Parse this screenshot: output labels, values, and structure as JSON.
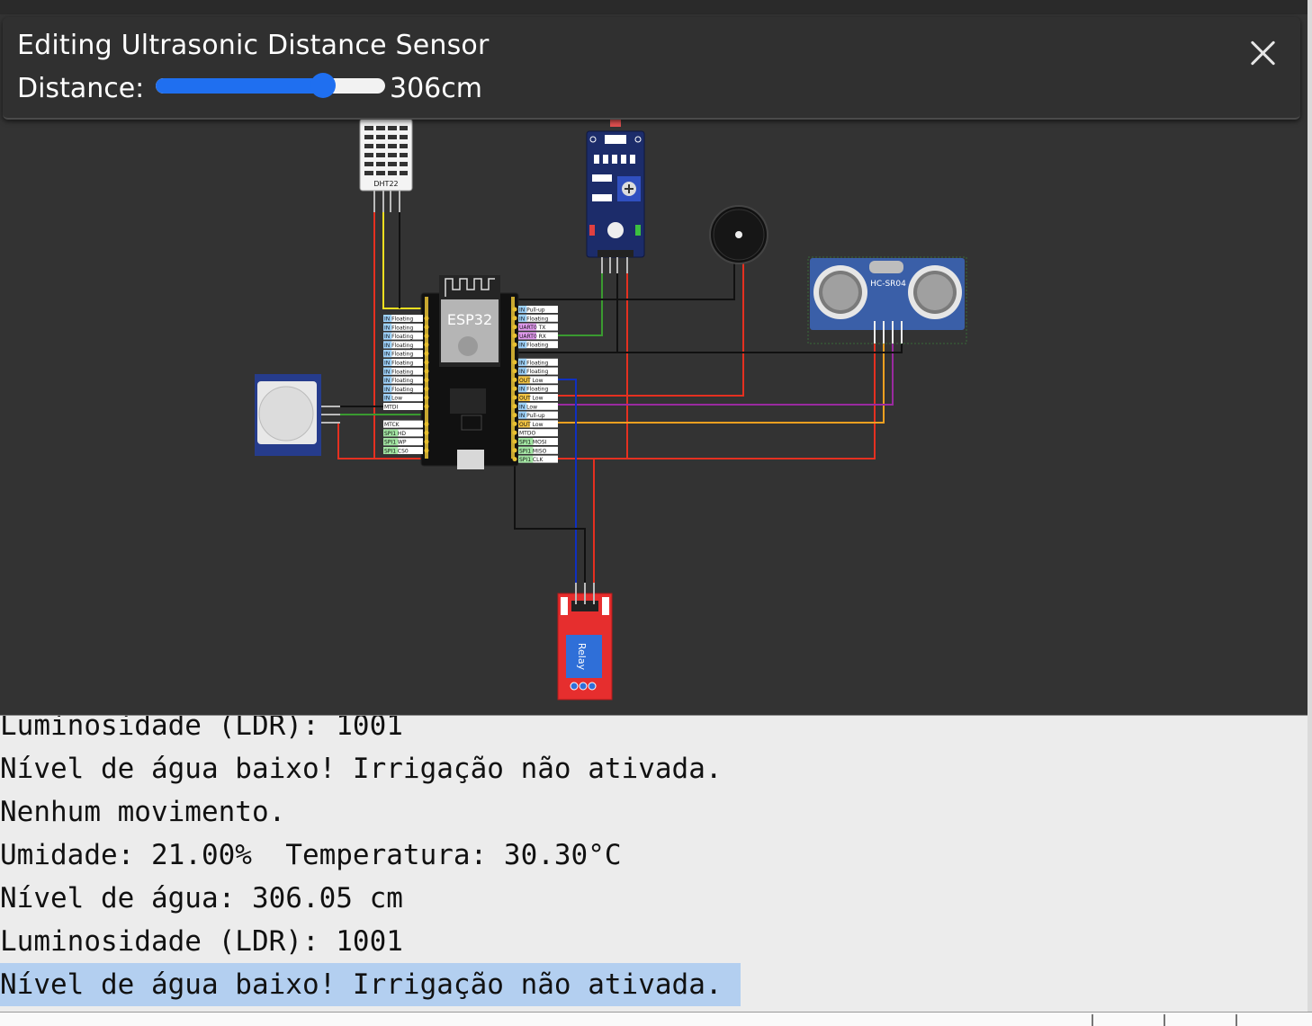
{
  "editor": {
    "title": "Editing Ultrasonic Distance Sensor",
    "distance_label": "Distance:",
    "distance_value": "306cm",
    "distance_fraction": 0.73,
    "close_icon": "close-icon",
    "accent_color": "#1f6ff0"
  },
  "circuit": {
    "esp32_label": "ESP32",
    "dht_label": "DHT22",
    "ultrasonic_label": "HC-SR04",
    "relay_label": "Relay",
    "left_pins": [
      "IN Floating",
      "IN Floating",
      "IN Floating",
      "IN Floating",
      "IN Floating",
      "IN Floating",
      "IN Floating",
      "IN Floating",
      "IN Floating",
      "IN Low",
      "MTDI",
      "",
      "MTCK",
      "SPI1 HD",
      "SPI1 WP",
      "SPI1 CS0"
    ],
    "right_pins": [
      "IN Pull-up",
      "IN Floating",
      "UART0 TX",
      "UART0 RX",
      "IN Floating",
      "",
      "IN Floating",
      "IN Floating",
      "OUT Low",
      "IN Floating",
      "OUT Low",
      "IN Low",
      "IN Pull-up",
      "OUT Low",
      "MTDO",
      "SPI1 MOSI",
      "SPI1 MISO",
      "SPI1 CLK"
    ]
  },
  "console": {
    "lines": [
      "Luminosidade (LDR): 1001",
      "Nível de água baixo! Irrigação não ativada.",
      "Nenhum movimento.",
      "Umidade: 21.00%  Temperatura: 30.30°C",
      "Nível de água: 306.05 cm",
      "Luminosidade (LDR): 1001",
      "Nível de água baixo! Irrigação não ativada."
    ],
    "selected_line": 6
  }
}
